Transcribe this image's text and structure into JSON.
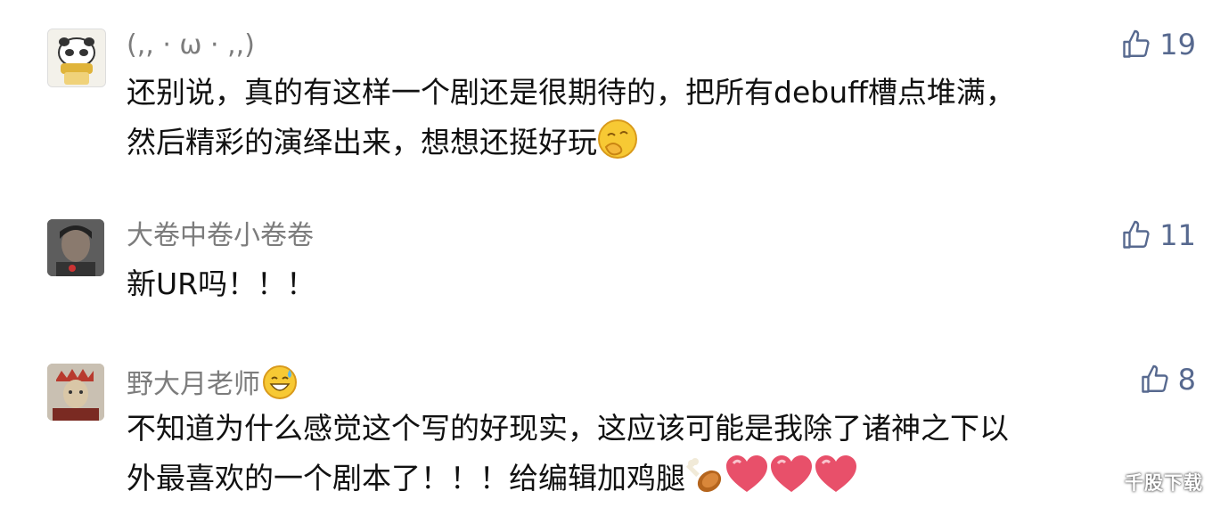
{
  "comments": [
    {
      "name": "(,, · ω · ,,)",
      "likes": "19",
      "lines": [
        "还别说，真的有这样一个剧还是很期待的，把所有debuff槽点堆满，",
        "然后精彩的演绎出来，想想还挺好玩"
      ],
      "avatar": "panda-avatar",
      "trailing_emoji": "thinking-hand-emoji"
    },
    {
      "name": "大卷中卷小卷卷",
      "likes": "11",
      "lines": [
        "新UR吗！！！"
      ],
      "avatar": "photo-avatar"
    },
    {
      "name": "野大月老师",
      "name_emoji": "sweat-smile-emoji",
      "likes": "8",
      "lines": [
        "不知道为什么感觉这个写的好现实，这应该可能是我除了诸神之下以",
        "外最喜欢的一个剧本了！！！给编辑加鸡腿"
      ],
      "avatar": "opera-avatar",
      "trailing_emojis": [
        "drumstick-emoji",
        "heart-emoji",
        "heart-emoji",
        "heart-emoji"
      ]
    }
  ],
  "watermark": "千股下载",
  "colors": {
    "name": "#7c7c7c",
    "like": "#57698f",
    "text": "#111111"
  }
}
